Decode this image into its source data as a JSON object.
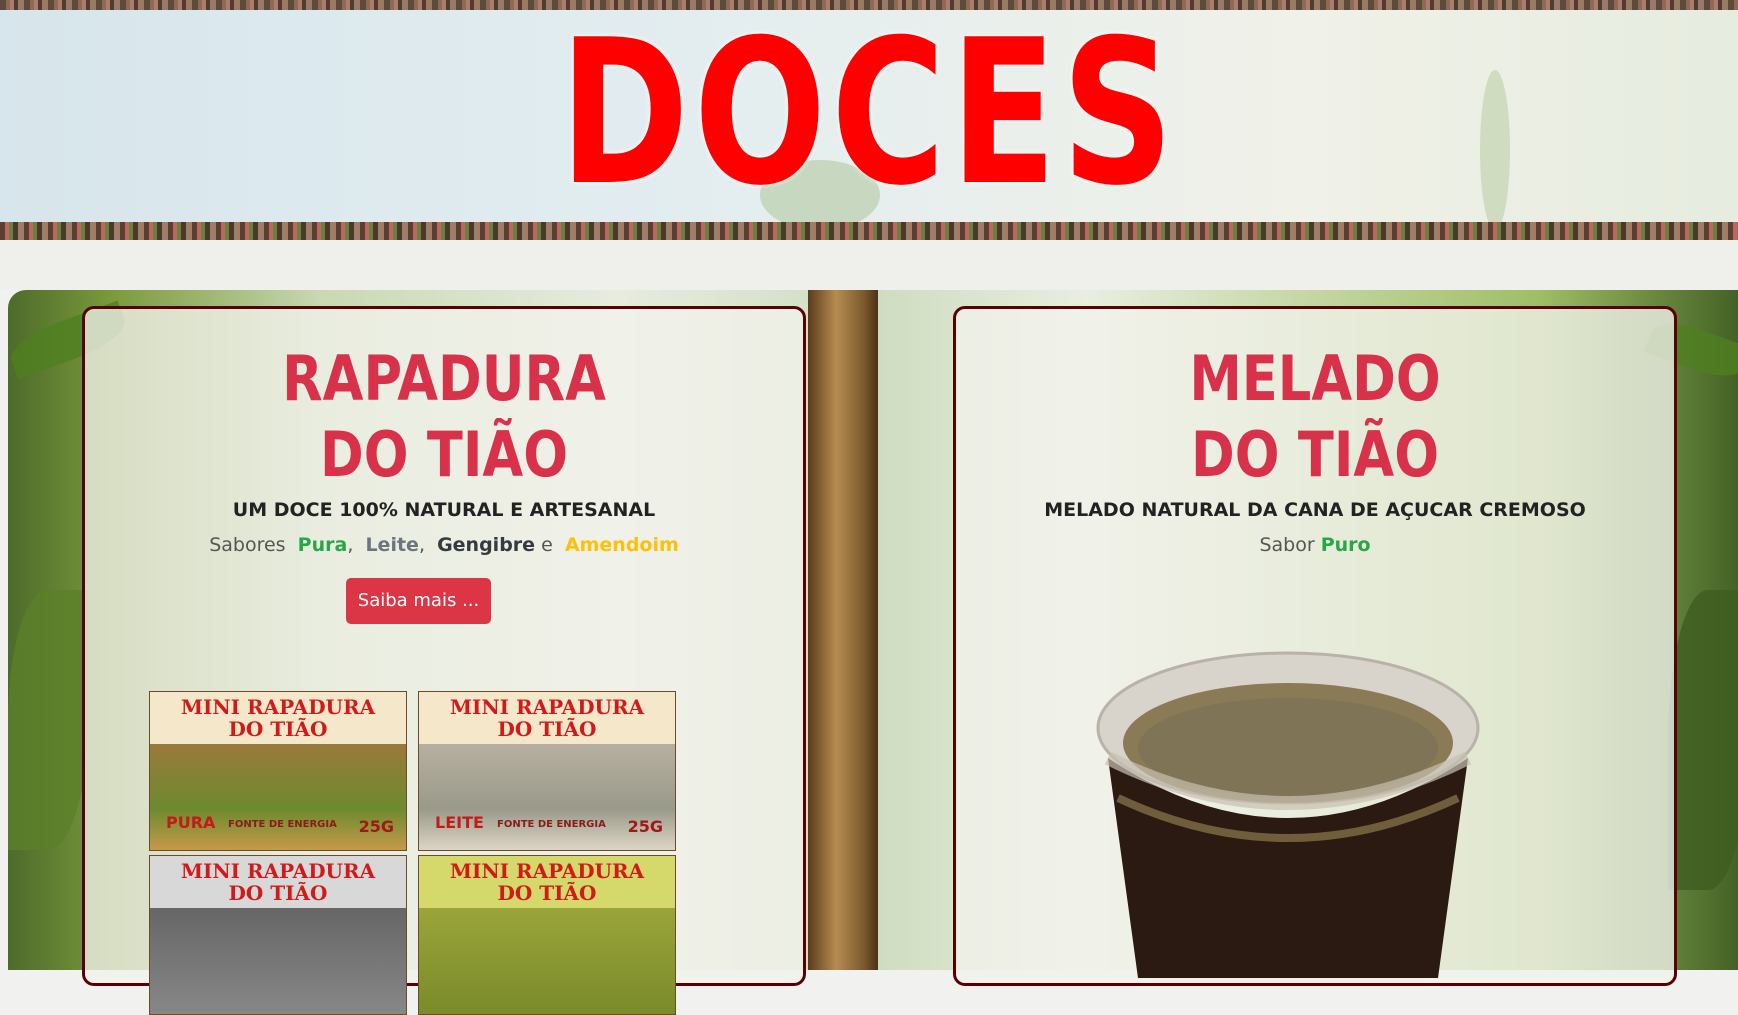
{
  "header": {
    "title": "DOCES"
  },
  "products": [
    {
      "title_line1": "RAPADURA",
      "title_line2": "DO TIÃO",
      "subtitle": "UM DOCE 100% NATURAL E ARTESANAL",
      "flavors_prefix": "Sabores",
      "flavors": [
        {
          "name": "Pura",
          "color": "#28a745"
        },
        {
          "name": "Leite",
          "color": "#6c757d"
        },
        {
          "name": "Gengibre",
          "color": "#343a40"
        },
        {
          "name": "Amendoim",
          "color": "#ffc107"
        }
      ],
      "sep1": ",",
      "sep2": ",",
      "conj": "e",
      "button_label": "Saiba mais ...",
      "package_boxes": [
        {
          "label_line1": "MINI RAPADURA",
          "label_line2": "DO TIÃO",
          "flavor": "PURA",
          "fonte": "FONTE DE ENERGIA",
          "weight": "25G"
        },
        {
          "label_line1": "MINI RAPADURA",
          "label_line2": "DO TIÃO",
          "flavor": "LEITE",
          "fonte": "FONTE DE ENERGIA",
          "weight": "25G"
        },
        {
          "label_line1": "MINI RAPADURA",
          "label_line2": "DO TIÃO"
        },
        {
          "label_line1": "MINI RAPADURA",
          "label_line2": "DO TIÃO"
        }
      ]
    },
    {
      "title_line1": "MELADO",
      "title_line2": "DO TIÃO",
      "subtitle": "MELADO NATURAL DA CANA DE AÇUCAR CREMOSO",
      "flavors_prefix": "Sabor",
      "flavors": [
        {
          "name": "Puro",
          "color": "#28a745"
        }
      ]
    }
  ],
  "colors": {
    "title_red": "#ff0000",
    "card_title": "#d8324a",
    "button": "#dc3545",
    "card_border": "#5a0000"
  }
}
